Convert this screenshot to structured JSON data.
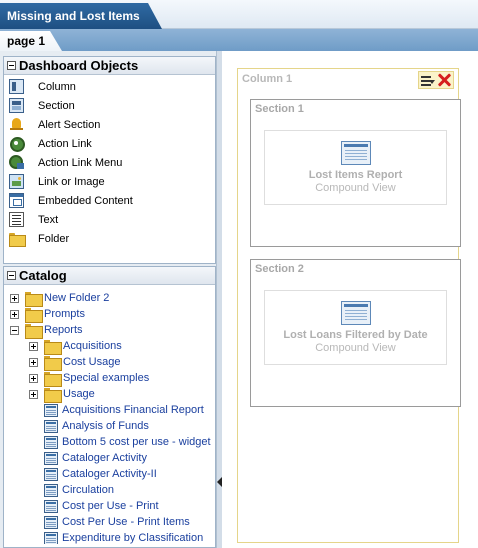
{
  "window": {
    "title": "Missing and Lost Items"
  },
  "page_tabs": [
    {
      "label": "page 1",
      "selected": true
    }
  ],
  "dashboard_objects": {
    "title": "Dashboard Objects",
    "items": [
      {
        "label": "Column",
        "icon": "column-icon"
      },
      {
        "label": "Section",
        "icon": "section-icon"
      },
      {
        "label": "Alert Section",
        "icon": "bell-icon"
      },
      {
        "label": "Action Link",
        "icon": "gear-link-icon"
      },
      {
        "label": "Action Link Menu",
        "icon": "gear-menu-icon"
      },
      {
        "label": "Link or Image",
        "icon": "image-icon"
      },
      {
        "label": "Embedded Content",
        "icon": "embedded-content-icon"
      },
      {
        "label": "Text",
        "icon": "text-icon"
      },
      {
        "label": "Folder",
        "icon": "folder-icon"
      }
    ]
  },
  "catalog": {
    "title": "Catalog",
    "tree": [
      {
        "label": "New Folder 2",
        "type": "folder",
        "expander": "plus",
        "level": 0
      },
      {
        "label": "Prompts",
        "type": "folder",
        "expander": "plus",
        "level": 0
      },
      {
        "label": "Reports",
        "type": "folder",
        "expander": "minus",
        "level": 0
      },
      {
        "label": "Acquisitions",
        "type": "folder",
        "expander": "plus",
        "level": 1
      },
      {
        "label": "Cost Usage",
        "type": "folder",
        "expander": "plus",
        "level": 1
      },
      {
        "label": "Special examples",
        "type": "folder",
        "expander": "plus",
        "level": 1
      },
      {
        "label": "Usage",
        "type": "folder",
        "expander": "plus",
        "level": 1
      },
      {
        "label": "Acquisitions Financial Report",
        "type": "report",
        "level": 1
      },
      {
        "label": "Analysis of Funds",
        "type": "report",
        "level": 1
      },
      {
        "label": "Bottom 5 cost per use - widget",
        "type": "report",
        "level": 1
      },
      {
        "label": "Cataloger Activity",
        "type": "report",
        "level": 1
      },
      {
        "label": "Cataloger Activity-II",
        "type": "report",
        "level": 1
      },
      {
        "label": "Circulation",
        "type": "report",
        "level": 1
      },
      {
        "label": "Cost per Use - Print",
        "type": "report",
        "level": 1
      },
      {
        "label": "Cost Per Use - Print Items",
        "type": "report",
        "level": 1
      },
      {
        "label": "Expenditure by Classification",
        "type": "report",
        "level": 1
      }
    ]
  },
  "layout": {
    "column_title": "Column 1",
    "sections": [
      {
        "title": "Section 1",
        "view_name": "Lost Items Report",
        "view_type": "Compound View"
      },
      {
        "title": "Section 2",
        "view_name": "Lost Loans Filtered by Date",
        "view_type": "Compound View"
      }
    ]
  }
}
